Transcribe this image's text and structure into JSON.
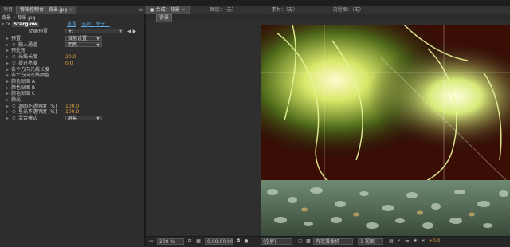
{
  "left_tabs": {
    "project": "项目",
    "effects_controls": "特效控制台：背景.jpg",
    "effects_controls_menu": "≡"
  },
  "right_tabs": {
    "composition": "合成：背景",
    "layer": "图层：（无）",
    "footage": "素材：（无）",
    "flowchart": "流程图：（无）"
  },
  "breadcrumb": "背景 • 背景.jpg",
  "effect": {
    "fx_marker": "fx",
    "name": "Starglow",
    "links": [
      "重置",
      "选项...",
      "关于..."
    ],
    "preset_label": "动画预置：",
    "preset_value": "无",
    "preset_nav": "◀ ▶",
    "params": [
      {
        "label": "预置",
        "type": "dropdown",
        "value": "当前设置"
      },
      {
        "label": "输入通道",
        "type": "dropdown",
        "value": "明亮"
      },
      {
        "label": "预处理",
        "type": "group"
      },
      {
        "label": "光线长度",
        "type": "number",
        "value": "20.0"
      },
      {
        "label": "提升亮度",
        "type": "number",
        "value": "0.0"
      },
      {
        "label": "各个方向光线长度",
        "type": "group"
      },
      {
        "label": "各个方向光线颜色",
        "type": "group"
      },
      {
        "label": "颜色贴图 A",
        "type": "group"
      },
      {
        "label": "颜色贴图 B",
        "type": "group"
      },
      {
        "label": "颜色贴图 C",
        "type": "group"
      },
      {
        "label": "微光",
        "type": "group"
      },
      {
        "label": "源图不透明度 [%]",
        "type": "number",
        "value": "100.0"
      },
      {
        "label": "星光不透明度 [%]",
        "type": "number",
        "value": "100.0"
      },
      {
        "label": "混合模式",
        "type": "dropdown",
        "value": "屏幕"
      }
    ]
  },
  "comp_badge": "背景",
  "bottom_bar": {
    "zoom": "200 %",
    "timecode": "0:00:00:00",
    "resolution": "(全屏)",
    "camera": "有效摄像机",
    "views": "1 视图",
    "exposure": "+0.0"
  },
  "icons": {
    "camera_icon": "📷",
    "stopwatch_icon": "⏱"
  }
}
